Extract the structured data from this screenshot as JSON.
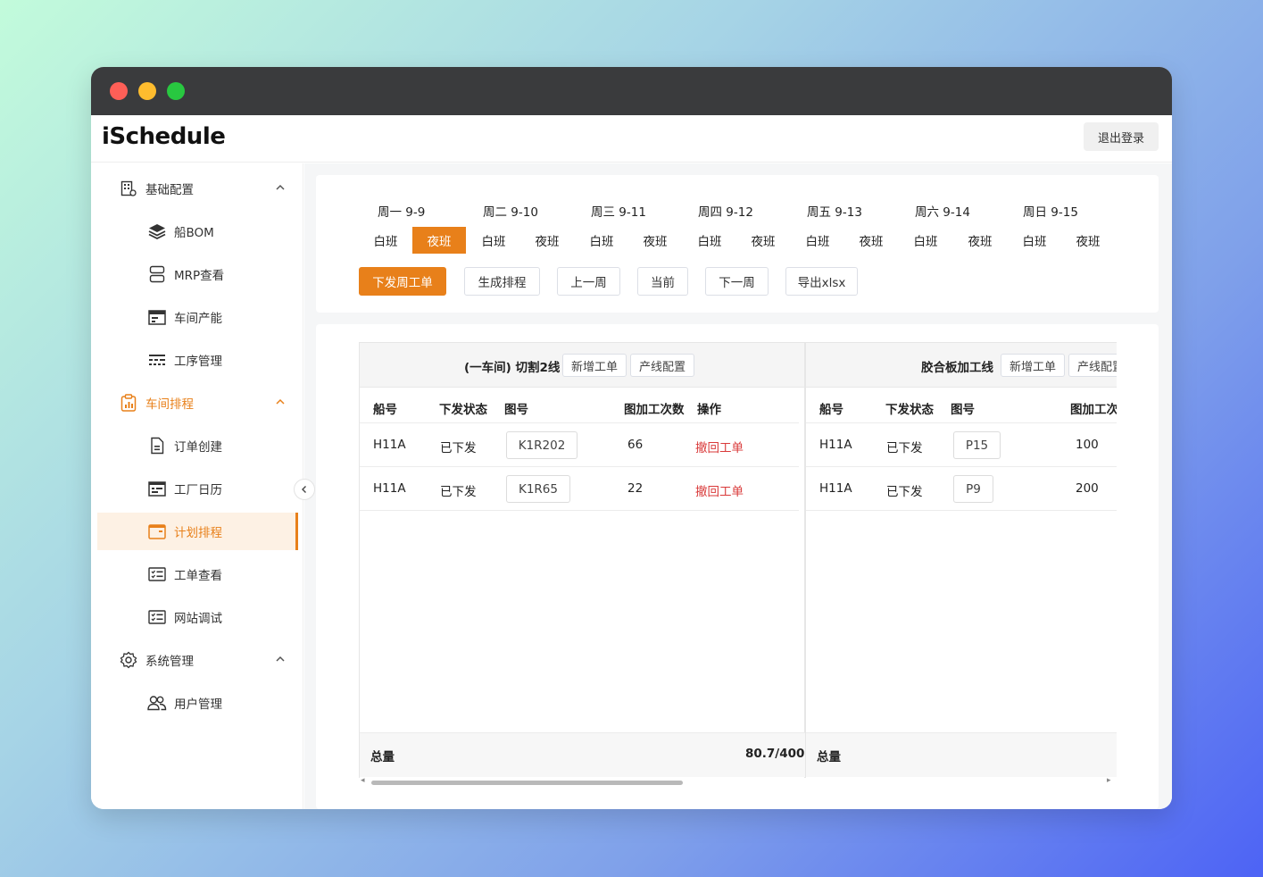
{
  "app": {
    "title": "iSchedule",
    "logout_label": "退出登录"
  },
  "sidebar": {
    "groups": [
      {
        "label": "基础配置",
        "icon": "grid-building-icon",
        "items": [
          {
            "label": "船BOM",
            "icon": "layers-icon"
          },
          {
            "label": "MRP查看",
            "icon": "server-icon"
          },
          {
            "label": "车间产能",
            "icon": "calendar-card-icon"
          },
          {
            "label": "工序管理",
            "icon": "process-list-icon"
          }
        ]
      },
      {
        "label": "车间排程",
        "icon": "clipboard-chart-icon",
        "active": true,
        "items": [
          {
            "label": "订单创建",
            "icon": "document-icon"
          },
          {
            "label": "工厂日历",
            "icon": "calendar-icon"
          },
          {
            "label": "计划排程",
            "icon": "schedule-icon",
            "active": true
          },
          {
            "label": "工单查看",
            "icon": "list-check-icon"
          },
          {
            "label": "网站调试",
            "icon": "list-check-icon"
          }
        ]
      },
      {
        "label": "系统管理",
        "icon": "gear-icon",
        "items": [
          {
            "label": "用户管理",
            "icon": "users-icon"
          }
        ]
      }
    ]
  },
  "week": {
    "days": [
      "周一 9-9",
      "周二 9-10",
      "周三 9-11",
      "周四 9-12",
      "周五 9-13",
      "周六 9-14",
      "周日 9-15"
    ],
    "shift_labels": {
      "day": "白班",
      "night": "夜班"
    },
    "selected": "周一 9-9 夜班",
    "buttons": {
      "issue": "下发周工单",
      "generate": "生成排程",
      "prev": "上一周",
      "current": "当前",
      "next": "下一周",
      "export": "导出xlsx"
    }
  },
  "board": {
    "lines": [
      {
        "title": "(一车间) 切割2线",
        "add_label": "新增工单",
        "config_label": "产线配置",
        "columns": [
          "船号",
          "下发状态",
          "图号",
          "图加工次数",
          "操作"
        ],
        "rows": [
          {
            "ship": "H11A",
            "status": "已下发",
            "drawing": "K1R202",
            "count": "66",
            "action": "撤回工单"
          },
          {
            "ship": "H11A",
            "status": "已下发",
            "drawing": "K1R65",
            "count": "22",
            "action": "撤回工单"
          }
        ],
        "total_label": "总量",
        "total_value": "80.7/400"
      },
      {
        "title": "胶合板加工线",
        "add_label": "新增工单",
        "config_label": "产线配置",
        "columns": [
          "船号",
          "下发状态",
          "图号",
          "图加工次数"
        ],
        "rows": [
          {
            "ship": "H11A",
            "status": "已下发",
            "drawing": "P15",
            "count": "100"
          },
          {
            "ship": "H11A",
            "status": "已下发",
            "drawing": "P9",
            "count": "200"
          }
        ],
        "total_label": "总量"
      }
    ]
  },
  "colors": {
    "accent": "#e8801a",
    "danger": "#d93a3a",
    "titlebar": "#3a3b3d"
  }
}
